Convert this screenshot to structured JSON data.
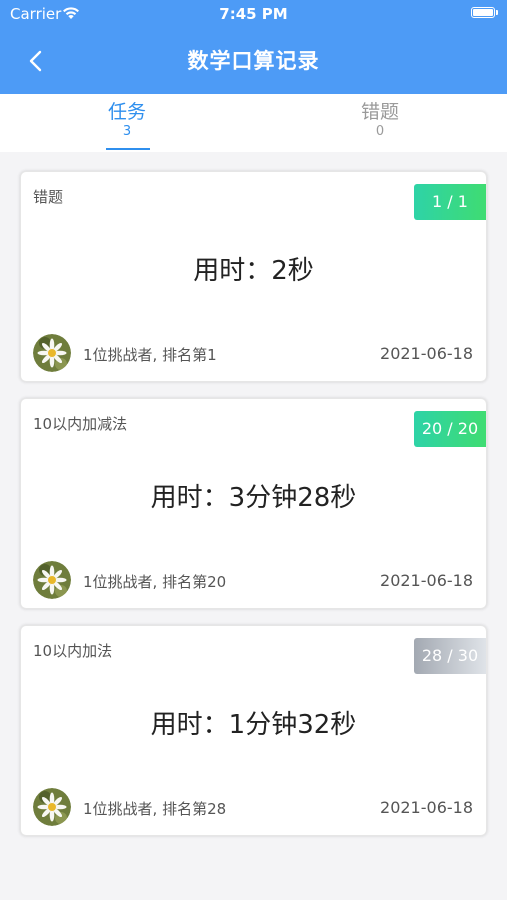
{
  "status_bar": {
    "carrier": "Carrier",
    "time": "7:45 PM"
  },
  "nav": {
    "title": "数学口算记录"
  },
  "tabs": [
    {
      "label": "任务",
      "count": "3",
      "active": true
    },
    {
      "label": "错题",
      "count": "0",
      "active": false
    }
  ],
  "records": [
    {
      "name": "错题",
      "progress": "1 / 1",
      "duration": "用时：2秒",
      "challengers": "1位挑战者, 排名第1",
      "date": "2021-06-18"
    },
    {
      "name": "10以内加减法",
      "progress": "20 / 20",
      "duration": "用时：3分钟28秒",
      "challengers": "1位挑战者, 排名第20",
      "date": "2021-06-18"
    },
    {
      "name": "10以内加法",
      "progress": "28 / 30",
      "duration": "用时：1分钟32秒",
      "challengers": "1位挑战者, 排名第28",
      "date": "2021-06-18"
    }
  ],
  "colors": {
    "header": "#4d9bf6",
    "active_tab": "#2f8fee",
    "badge_complete": "#2ed3a7",
    "badge_incomplete": "#a3a9b2"
  }
}
